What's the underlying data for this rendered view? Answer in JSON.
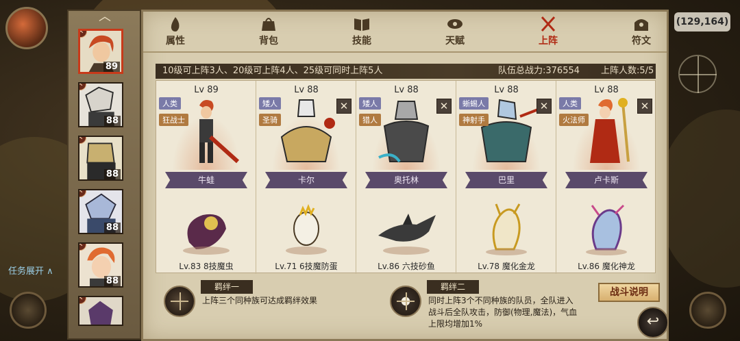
{
  "background": {
    "task_label": "任务展开 ∧",
    "coords": "(129,164)"
  },
  "hero_list": [
    {
      "level": "89",
      "active": true
    },
    {
      "level": "88"
    },
    {
      "level": "88"
    },
    {
      "level": "88"
    },
    {
      "level": "88"
    }
  ],
  "tabs": [
    {
      "label": "属性",
      "icon": "fire-icon"
    },
    {
      "label": "背包",
      "icon": "bag-icon"
    },
    {
      "label": "技能",
      "icon": "book-icon"
    },
    {
      "label": "天赋",
      "icon": "eye-icon"
    },
    {
      "label": "上阵",
      "icon": "swords-icon",
      "active": true
    },
    {
      "label": "符文",
      "icon": "rune-icon"
    }
  ],
  "info": {
    "rule": "10级可上阵3人、20级可上阵4人、25级可同时上阵5人",
    "power": "队伍总战力:376554",
    "count": "上阵人数:5/5"
  },
  "members": [
    {
      "level": "Lv 89",
      "race": "人类",
      "class": "狂战士",
      "name": "牛蛙",
      "pet": "Lv.83 8技魔虫",
      "removable": false
    },
    {
      "level": "Lv 88",
      "race": "矮人",
      "class": "圣骑",
      "name": "卡尔",
      "pet": "Lv.71 6技魔防蛋",
      "removable": true
    },
    {
      "level": "Lv 88",
      "race": "矮人",
      "class": "猎人",
      "name": "奥托林",
      "pet": "Lv.86 六技砂鱼",
      "removable": true
    },
    {
      "level": "Lv 88",
      "race": "蜥蜴人",
      "class": "神射手",
      "name": "巴里",
      "pet": "Lv.78 魔化金龙",
      "removable": true
    },
    {
      "level": "Lv 88",
      "race": "人类",
      "class": "火法师",
      "name": "卢卡斯",
      "pet": "Lv.86 魔化神龙",
      "removable": true
    }
  ],
  "remove_symbol": "✕",
  "bonds": [
    {
      "title": "羁绊一",
      "desc": [
        "上阵三个同种族可达成羁绊效果"
      ]
    },
    {
      "title": "羁绊二",
      "desc": [
        "同时上阵3个不同种族的队员，全队进入",
        "战斗后全队攻击，防御(物理,魔法)，气血",
        "上限均增加1%"
      ]
    }
  ],
  "battle_button": "战斗说明",
  "colors": {
    "accent_red": "#b02a14",
    "panel_bg": "#d8cdb0",
    "banner": "#5a4a6a"
  }
}
